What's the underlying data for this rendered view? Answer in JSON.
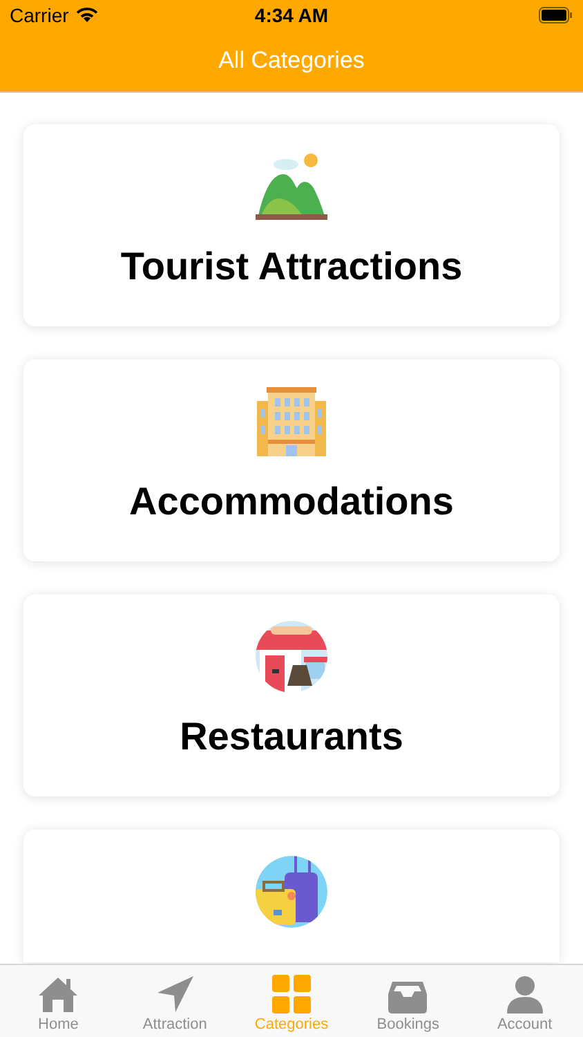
{
  "status_bar": {
    "carrier": "Carrier",
    "time": "4:34 AM"
  },
  "header": {
    "title": "All Categories"
  },
  "categories": [
    {
      "kind": "landscape",
      "title": "Tourist Attractions"
    },
    {
      "kind": "hotel",
      "title": "Accommodations"
    },
    {
      "kind": "restaurant",
      "title": "Restaurants"
    },
    {
      "kind": "luggage"
    }
  ],
  "tab_bar": [
    {
      "kind": "home",
      "label": "Home",
      "selected": false
    },
    {
      "kind": "navigation",
      "label": "Attraction",
      "selected": false
    },
    {
      "kind": "grid",
      "label": "Categories",
      "selected": true
    },
    {
      "kind": "tray",
      "label": "Bookings",
      "selected": false
    },
    {
      "kind": "person",
      "label": "Account",
      "selected": false
    }
  ]
}
